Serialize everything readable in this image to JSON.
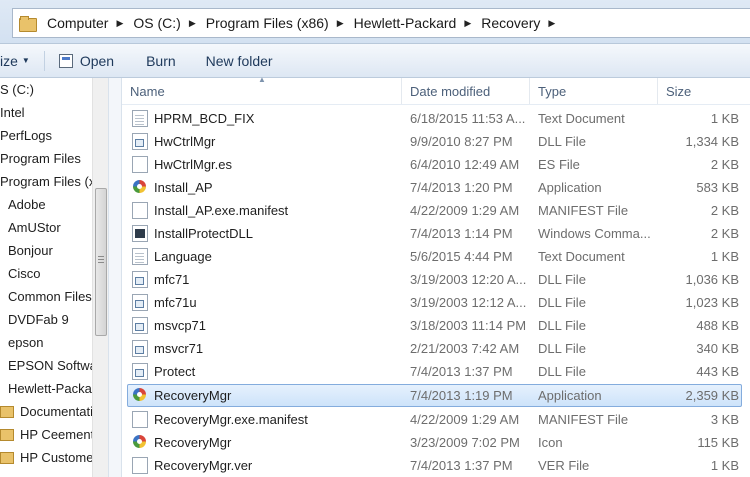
{
  "address": {
    "crumbs": [
      "Computer",
      "OS (C:)",
      "Program Files (x86)",
      "Hewlett-Packard",
      "Recovery"
    ]
  },
  "toolbar": {
    "organize_label": "ize",
    "open_label": "Open",
    "burn_label": "Burn",
    "new_folder_label": "New folder"
  },
  "nav": {
    "items": [
      {
        "label": "S (C:)",
        "folder": false
      },
      {
        "label": "Intel",
        "folder": false
      },
      {
        "label": "PerfLogs",
        "folder": false
      },
      {
        "label": "Program Files",
        "folder": false
      },
      {
        "label": "Program Files (x",
        "folder": false
      },
      {
        "label": "Adobe",
        "folder": false
      },
      {
        "label": "AmUStor",
        "folder": false
      },
      {
        "label": "Bonjour",
        "folder": false
      },
      {
        "label": "Cisco",
        "folder": false
      },
      {
        "label": "Common Files",
        "folder": false
      },
      {
        "label": "DVDFab 9",
        "folder": false
      },
      {
        "label": "epson",
        "folder": false
      },
      {
        "label": "EPSON Softwa",
        "folder": false
      },
      {
        "label": "Hewlett-Packa",
        "folder": false
      },
      {
        "label": "Documentati",
        "folder": true
      },
      {
        "label": "HP Ceement",
        "folder": true
      },
      {
        "label": "HP Customer",
        "folder": true
      }
    ]
  },
  "columns": {
    "name": "Name",
    "date": "Date modified",
    "type": "Type",
    "size": "Size"
  },
  "files": [
    {
      "name": "HPRM_BCD_FIX",
      "date": "6/18/2015 11:53 A...",
      "type": "Text Document",
      "size": "1 KB",
      "icon": "doc"
    },
    {
      "name": "HwCtrlMgr",
      "date": "9/9/2010 8:27 PM",
      "type": "DLL File",
      "size": "1,334 KB",
      "icon": "dll"
    },
    {
      "name": "HwCtrlMgr.es",
      "date": "6/4/2010 12:49 AM",
      "type": "ES File",
      "size": "2 KB",
      "icon": "blank"
    },
    {
      "name": "Install_AP",
      "date": "7/4/2013 1:20 PM",
      "type": "Application",
      "size": "583 KB",
      "icon": "app"
    },
    {
      "name": "Install_AP.exe.manifest",
      "date": "4/22/2009 1:29 AM",
      "type": "MANIFEST File",
      "size": "2 KB",
      "icon": "blank"
    },
    {
      "name": "InstallProtectDLL",
      "date": "7/4/2013 1:14 PM",
      "type": "Windows Comma...",
      "size": "2 KB",
      "icon": "cmd"
    },
    {
      "name": "Language",
      "date": "5/6/2015 4:44 PM",
      "type": "Text Document",
      "size": "1 KB",
      "icon": "doc"
    },
    {
      "name": "mfc71",
      "date": "3/19/2003 12:20 A...",
      "type": "DLL File",
      "size": "1,036 KB",
      "icon": "dll"
    },
    {
      "name": "mfc71u",
      "date": "3/19/2003 12:12 A...",
      "type": "DLL File",
      "size": "1,023 KB",
      "icon": "dll"
    },
    {
      "name": "msvcp71",
      "date": "3/18/2003 11:14 PM",
      "type": "DLL File",
      "size": "488 KB",
      "icon": "dll"
    },
    {
      "name": "msvcr71",
      "date": "2/21/2003 7:42 AM",
      "type": "DLL File",
      "size": "340 KB",
      "icon": "dll"
    },
    {
      "name": "Protect",
      "date": "7/4/2013 1:37 PM",
      "type": "DLL File",
      "size": "443 KB",
      "icon": "dll"
    },
    {
      "name": "RecoveryMgr",
      "date": "7/4/2013 1:19 PM",
      "type": "Application",
      "size": "2,359 KB",
      "icon": "app",
      "selected": true
    },
    {
      "name": "RecoveryMgr.exe.manifest",
      "date": "4/22/2009 1:29 AM",
      "type": "MANIFEST File",
      "size": "3 KB",
      "icon": "blank"
    },
    {
      "name": "RecoveryMgr",
      "date": "3/23/2009 7:02 PM",
      "type": "Icon",
      "size": "115 KB",
      "icon": "app"
    },
    {
      "name": "RecoveryMgr.ver",
      "date": "7/4/2013 1:37 PM",
      "type": "VER File",
      "size": "1 KB",
      "icon": "blank"
    }
  ]
}
